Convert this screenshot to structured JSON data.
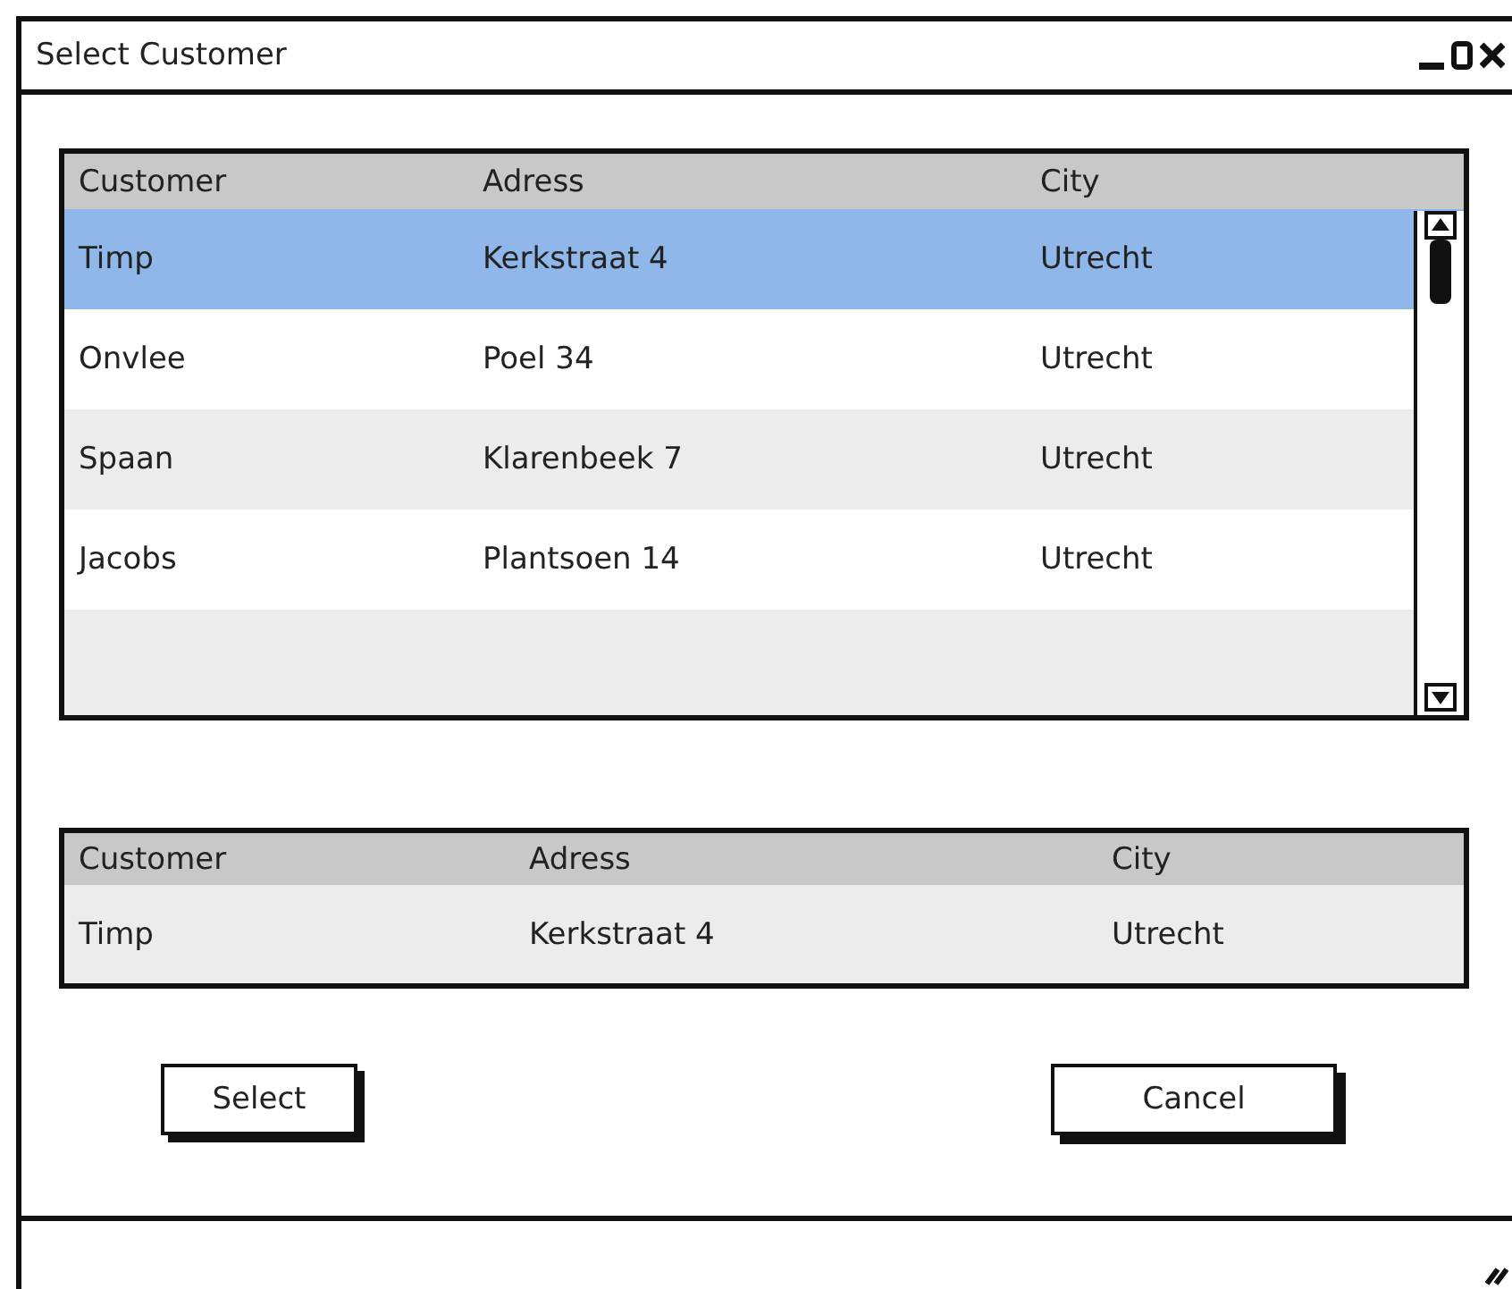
{
  "window": {
    "title": "Select Customer"
  },
  "customers_table": {
    "columns": [
      "Customer",
      "Adress",
      "City"
    ],
    "rows": [
      {
        "cells": [
          "Timp",
          "Kerkstraat 4",
          "Utrecht"
        ],
        "selected": true
      },
      {
        "cells": [
          "Onvlee",
          "Poel 34",
          "Utrecht"
        ],
        "selected": false
      },
      {
        "cells": [
          "Spaan",
          "Klarenbeek 7",
          "Utrecht"
        ],
        "selected": false
      },
      {
        "cells": [
          "Jacobs",
          "Plantsoen 14",
          "Utrecht"
        ],
        "selected": false
      }
    ]
  },
  "selection_table": {
    "columns": [
      "Customer",
      "Adress",
      "City"
    ],
    "rows": [
      {
        "cells": [
          "Timp",
          "Kerkstraat 4",
          "Utrecht"
        ]
      }
    ]
  },
  "buttons": [
    {
      "label": "Select",
      "kind": "primary"
    },
    {
      "label": "Cancel",
      "kind": "secondary"
    }
  ]
}
